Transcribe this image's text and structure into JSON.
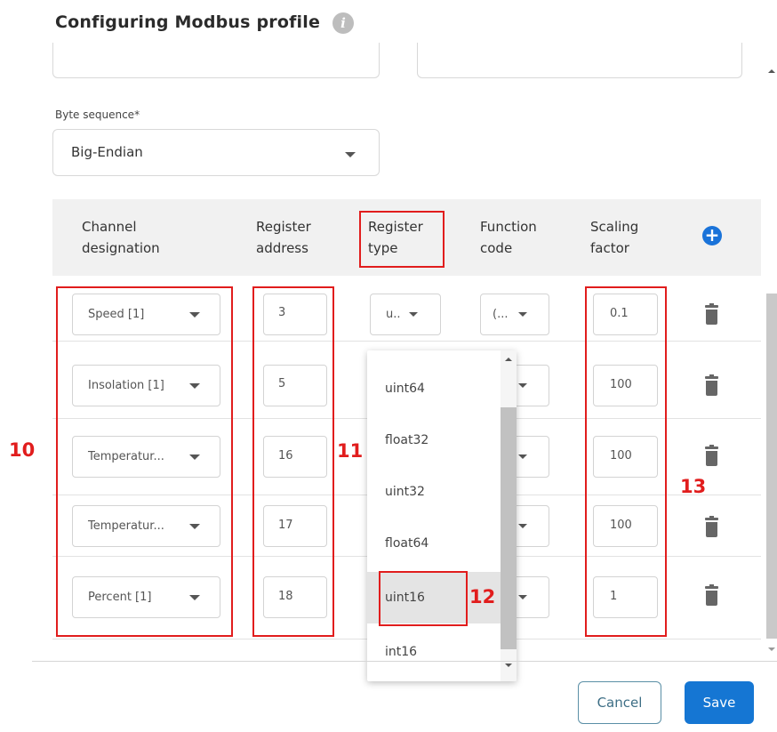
{
  "dialog": {
    "title": "Configuring Modbus profile",
    "info_icon": "info-icon"
  },
  "top_fields": {
    "left_value": "",
    "right_value": ""
  },
  "byte_sequence": {
    "label": "Byte sequence*",
    "value": "Big-Endian"
  },
  "table": {
    "headers": {
      "channel_line1": "Channel",
      "channel_line2": "designation",
      "register_address_line1": "Register",
      "register_address_line2": "address",
      "register_type_line1": "Register",
      "register_type_line2": "type",
      "function_code_line1": "Function",
      "function_code_line2": "code",
      "scaling_line1": "Scaling",
      "scaling_line2": "factor"
    },
    "add_icon": "plus-circle-icon",
    "rows": [
      {
        "channel": "Speed [1]",
        "address": "3",
        "type": "u..",
        "function": "(...",
        "scaling": "0.1"
      },
      {
        "channel": "Insolation [1]",
        "address": "5",
        "type": "",
        "function": "",
        "scaling": "100"
      },
      {
        "channel": "Temperatur...",
        "address": "16",
        "type": "",
        "function": "",
        "scaling": "100"
      },
      {
        "channel": "Temperatur...",
        "address": "17",
        "type": "",
        "function": "",
        "scaling": "100"
      },
      {
        "channel": "Percent [1]",
        "address": "18",
        "type": "",
        "function": "",
        "scaling": "1"
      }
    ]
  },
  "register_type_dropdown": {
    "options": [
      "uint64",
      "float32",
      "uint32",
      "float64",
      "uint16",
      "int16"
    ],
    "highlighted": "uint16"
  },
  "annotations": {
    "n10": "10",
    "n11": "11",
    "n12": "12",
    "n13": "13",
    "color": "#e11d1d"
  },
  "footer": {
    "cancel_label": "Cancel",
    "save_label": "Save"
  },
  "colors": {
    "accent": "#1576d3",
    "header_bg": "#f1f1f1"
  }
}
